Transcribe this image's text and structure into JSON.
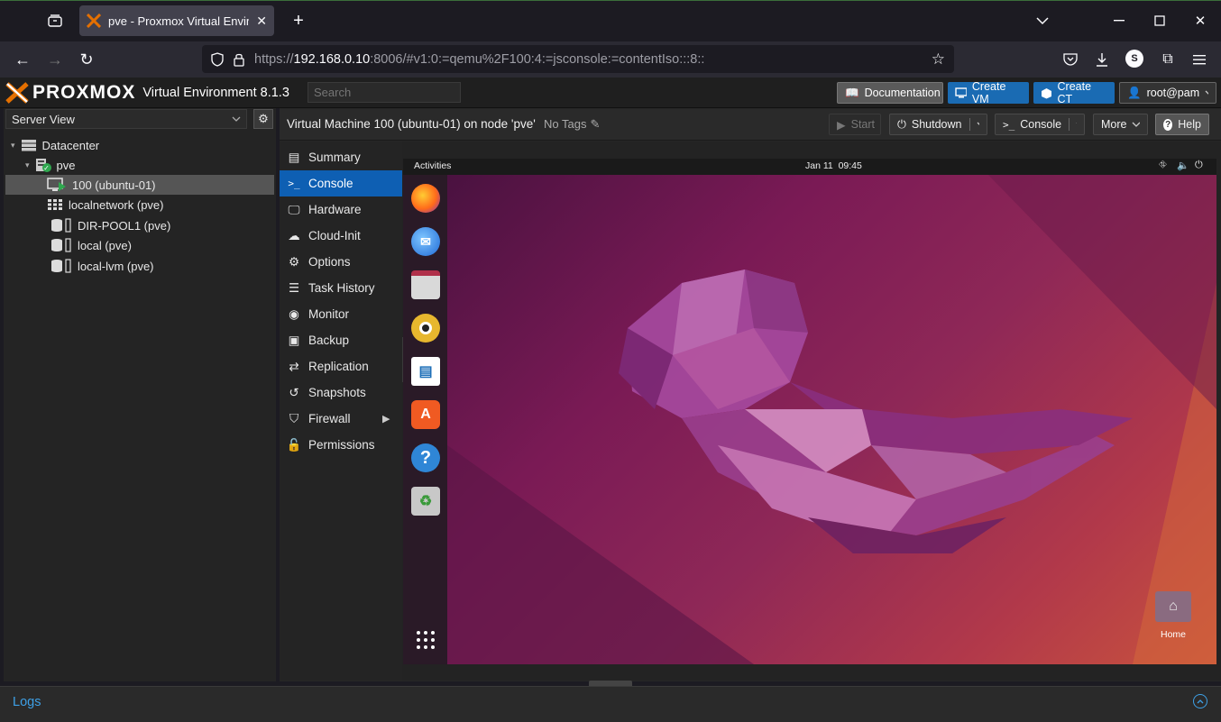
{
  "browser": {
    "tab_title": "pve - Proxmox Virtual Environment",
    "url_prefix": "https://",
    "url_host": "192.168.0.10",
    "url_rest": ":8006/#v1:0:=qemu%2F100:4:=jsconsole:=contentIso:::8::",
    "profile_letter": "S"
  },
  "header": {
    "logo_text": "PROXMOX",
    "product": "Virtual Environment 8.1.3",
    "search_placeholder": "Search",
    "documentation": "Documentation",
    "create_vm": "Create VM",
    "create_ct": "Create CT",
    "user": "root@pam"
  },
  "left": {
    "view": "Server View",
    "tree": [
      {
        "label": "Datacenter",
        "icon": "server-icon"
      },
      {
        "label": "pve",
        "icon": "node-icon"
      },
      {
        "label": "100 (ubuntu-01)",
        "icon": "vm-icon",
        "selected": true
      },
      {
        "label": "localnetwork (pve)",
        "icon": "grid-icon"
      },
      {
        "label": "DIR-POOL1 (pve)",
        "icon": "storage-icon"
      },
      {
        "label": "local (pve)",
        "icon": "storage-icon"
      },
      {
        "label": "local-lvm (pve)",
        "icon": "storage-icon"
      }
    ]
  },
  "vm": {
    "title": "Virtual Machine 100 (ubuntu-01) on node 'pve'",
    "no_tags": "No Tags",
    "start": "Start",
    "shutdown": "Shutdown",
    "console": "Console",
    "more": "More",
    "help": "Help"
  },
  "menu": [
    {
      "label": "Summary",
      "icon": "book-icon"
    },
    {
      "label": "Console",
      "icon": "terminal-icon",
      "selected": true
    },
    {
      "label": "Hardware",
      "icon": "monitor-icon"
    },
    {
      "label": "Cloud-Init",
      "icon": "cloud-icon"
    },
    {
      "label": "Options",
      "icon": "gear-icon"
    },
    {
      "label": "Task History",
      "icon": "list-icon"
    },
    {
      "label": "Monitor",
      "icon": "eye-icon"
    },
    {
      "label": "Backup",
      "icon": "floppy-icon"
    },
    {
      "label": "Replication",
      "icon": "retweet-icon"
    },
    {
      "label": "Snapshots",
      "icon": "history-icon"
    },
    {
      "label": "Firewall",
      "icon": "shield-icon",
      "submenu": true
    },
    {
      "label": "Permissions",
      "icon": "unlock-icon"
    }
  ],
  "guest": {
    "activities": "Activities",
    "clock": "Jan 11  09:45",
    "home_label": "Home"
  },
  "footer": {
    "logs": "Logs"
  },
  "colors": {
    "accent": "#0e5fb3",
    "header_button": "#1a6bb3",
    "logo_orange": "#e57000"
  }
}
